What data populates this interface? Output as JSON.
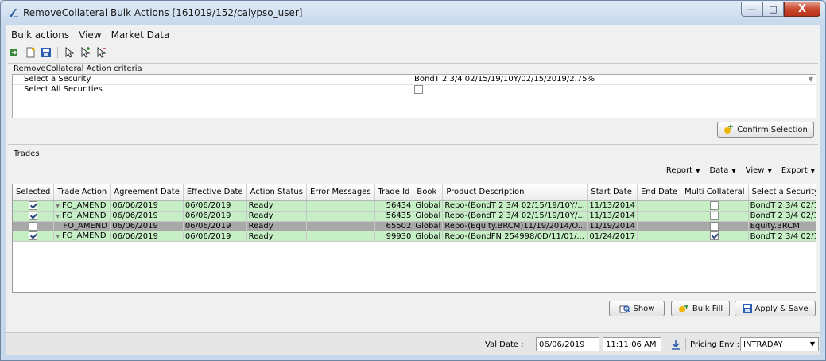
{
  "window": {
    "title": "RemoveCollateral Bulk Actions [161019/152/calypso_user]",
    "controls": {
      "minimize": "—",
      "maximize": "□",
      "close": "X"
    }
  },
  "menu": [
    "Bulk actions",
    "View",
    "Market Data"
  ],
  "toolbar_icons": [
    "load-icon",
    "new-icon",
    "save-icon",
    "pointer-icon",
    "pointer-add-icon",
    "pointer-remove-icon"
  ],
  "criteria": {
    "title": "RemoveCollateral Action criteria",
    "rows": [
      {
        "label": "Select a Security",
        "value": "BondT 2 3/4 02/15/19/10Y/02/15/2019/2.75%"
      },
      {
        "label": "Select All Securities",
        "checked": false
      }
    ],
    "confirm_button": "Confirm Selection"
  },
  "trades": {
    "title": "Trades",
    "report_menu": [
      "Report",
      "Data",
      "View",
      "Export"
    ],
    "columns": [
      "Selected",
      "Trade Action",
      "Agreement Date",
      "Effective Date",
      "Action Status",
      "Error Messages",
      "Trade Id",
      "Book",
      "Product Description",
      "Start Date",
      "End Date",
      "Multi Collateral",
      "Select a Security"
    ],
    "rows": [
      {
        "selected": true,
        "trade_action": "FO_AMEND",
        "has_dropdown": true,
        "agreement_date": "06/06/2019",
        "effective_date": "06/06/2019",
        "action_status": "Ready",
        "error": "",
        "trade_id": "56434",
        "book": "Global",
        "product": "Repo-(BondT 2 3/4 02/15/19/10Y/...",
        "start_date": "11/13/2014",
        "end_date": "",
        "multi_collateral": false,
        "security": "BondT 2 3/4 02/15/...",
        "style": "green"
      },
      {
        "selected": true,
        "trade_action": "FO_AMEND",
        "has_dropdown": true,
        "agreement_date": "06/06/2019",
        "effective_date": "06/06/2019",
        "action_status": "Ready",
        "error": "",
        "trade_id": "56435",
        "book": "Global",
        "product": "Repo-(BondT 2 3/4 02/15/19/10Y/...",
        "start_date": "11/13/2014",
        "end_date": "",
        "multi_collateral": false,
        "security": "BondT 2 3/4 02/15/...",
        "style": "green"
      },
      {
        "selected": false,
        "trade_action": "FO_AMEND",
        "has_dropdown": false,
        "agreement_date": "06/06/2019",
        "effective_date": "06/06/2019",
        "action_status": "Ready",
        "error": "",
        "trade_id": "65502",
        "book": "Global",
        "product": "Repo-(Equity.BRCM)11/19/2014/O...",
        "start_date": "11/19/2014",
        "end_date": "",
        "multi_collateral": false,
        "security": "Equity.BRCM",
        "style": "gray"
      },
      {
        "selected": true,
        "trade_action": "FO_AMEND",
        "has_dropdown": true,
        "agreement_date": "06/06/2019",
        "effective_date": "06/06/2019",
        "action_status": "Ready",
        "error": "",
        "trade_id": "99930",
        "book": "Global",
        "product": "Repo-(BondFN 254998/0D/11/01/...",
        "start_date": "01/24/2017",
        "end_date": "",
        "multi_collateral": true,
        "security": "BondT 2 3/4 02/15/...",
        "style": "green"
      }
    ]
  },
  "actions": {
    "show": "Show",
    "bulk_fill": "Bulk Fill",
    "apply_save": "Apply & Save"
  },
  "status": {
    "val_date_label": "Val Date :",
    "val_date": "06/06/2019",
    "val_time": "11:11:06 AM",
    "pricing_env_label": "Pricing Env :",
    "pricing_env": "INTRADAY"
  },
  "colors": {
    "selected_row": "#c6efc6",
    "excluded_row": "#a8a8a8",
    "save_icon": "#2a5db0"
  }
}
